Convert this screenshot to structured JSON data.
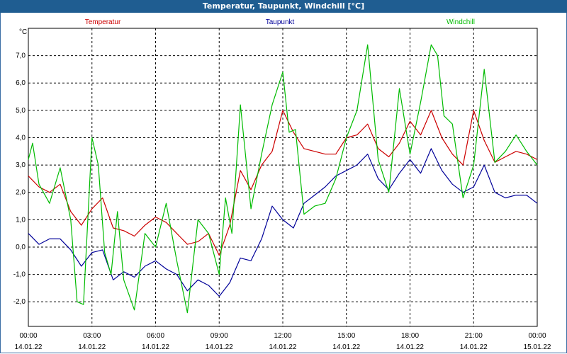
{
  "window": {
    "title": "Temperatur, Taupunkt, Windchill [°C]"
  },
  "chart_data": {
    "type": "line",
    "title": "Temperatur, Taupunkt, Windchill [°C]",
    "ylabel": "°C",
    "ylim": [
      -2.9,
      8.0
    ],
    "xlim": [
      0,
      24
    ],
    "grid": true,
    "legend_placement": "top",
    "y_ticks": [
      -2.0,
      -1.0,
      0.0,
      1.0,
      2.0,
      3.0,
      4.0,
      5.0,
      6.0,
      7.0
    ],
    "y_tick_labels": [
      "-2,0",
      "-1,0",
      "0,0",
      "1,0",
      "2,0",
      "3,0",
      "4,0",
      "5,0",
      "6,0",
      "7,0"
    ],
    "x_ticks": [
      0,
      3,
      6,
      9,
      12,
      15,
      18,
      21,
      24
    ],
    "x_tick_labels": [
      {
        "time": "00:00",
        "date": "14.01.22"
      },
      {
        "time": "03:00",
        "date": "14.01.22"
      },
      {
        "time": "06:00",
        "date": "14.01.22"
      },
      {
        "time": "09:00",
        "date": "14.01.22"
      },
      {
        "time": "12:00",
        "date": "14.01.22"
      },
      {
        "time": "15:00",
        "date": "14.01.22"
      },
      {
        "time": "18:00",
        "date": "14.01.22"
      },
      {
        "time": "21:00",
        "date": "14.01.22"
      },
      {
        "time": "00:00",
        "date": "15.01.22"
      }
    ],
    "series": [
      {
        "name": "Temperatur",
        "color": "#cc0000",
        "x": [
          0,
          0.5,
          1,
          1.5,
          2,
          2.5,
          3,
          3.5,
          4,
          4.5,
          5,
          5.5,
          6,
          6.5,
          7,
          7.5,
          8,
          8.5,
          9,
          9.5,
          10,
          10.5,
          11,
          11.5,
          12,
          12.5,
          13,
          13.5,
          14,
          14.5,
          15,
          15.5,
          16,
          16.5,
          17,
          17.5,
          18,
          18.5,
          19,
          19.5,
          20,
          20.5,
          21,
          21.5,
          22,
          22.5,
          23,
          23.5,
          24
        ],
        "values": [
          2.6,
          2.2,
          2.0,
          2.3,
          1.3,
          0.8,
          1.4,
          1.8,
          0.7,
          0.6,
          0.4,
          0.8,
          1.1,
          0.9,
          0.5,
          0.1,
          0.2,
          0.5,
          -0.3,
          0.8,
          2.8,
          2.1,
          3.0,
          3.5,
          5.0,
          4.2,
          3.6,
          3.5,
          3.4,
          3.4,
          4.0,
          4.1,
          4.5,
          3.6,
          3.3,
          3.8,
          4.6,
          4.1,
          5.0,
          4.0,
          3.4,
          3.0,
          5.0,
          3.9,
          3.1,
          3.3,
          3.5,
          3.4,
          3.2
        ]
      },
      {
        "name": "Taupunkt",
        "color": "#000099",
        "x": [
          0,
          0.5,
          1,
          1.5,
          2,
          2.5,
          3,
          3.5,
          4,
          4.5,
          5,
          5.5,
          6,
          6.5,
          7,
          7.5,
          8,
          8.5,
          9,
          9.5,
          10,
          10.5,
          11,
          11.5,
          12,
          12.5,
          13,
          13.5,
          14,
          14.5,
          15,
          15.5,
          16,
          16.5,
          17,
          17.5,
          18,
          18.5,
          19,
          19.5,
          20,
          20.5,
          21,
          21.5,
          22,
          22.5,
          23,
          23.5,
          24
        ],
        "values": [
          0.5,
          0.1,
          0.3,
          0.3,
          -0.1,
          -0.7,
          -0.2,
          -0.1,
          -1.2,
          -0.9,
          -1.1,
          -0.7,
          -0.5,
          -0.8,
          -1.0,
          -1.6,
          -1.2,
          -1.4,
          -1.8,
          -1.3,
          -0.4,
          -0.5,
          0.3,
          1.5,
          1.0,
          0.7,
          1.6,
          1.9,
          2.2,
          2.6,
          2.8,
          3.0,
          3.4,
          2.5,
          2.1,
          2.7,
          3.2,
          2.7,
          3.6,
          2.8,
          2.3,
          2.0,
          2.2,
          3.0,
          2.0,
          1.8,
          1.9,
          1.9,
          1.6
        ]
      },
      {
        "name": "Windchill",
        "color": "#00bb00",
        "x": [
          0,
          0.2,
          0.5,
          1,
          1.5,
          2,
          2.3,
          2.6,
          3,
          3.3,
          3.6,
          3.9,
          4.2,
          4.5,
          5,
          5.5,
          6,
          6.5,
          7,
          7.5,
          8,
          8.5,
          9,
          9.3,
          9.6,
          10,
          10.5,
          11,
          11.5,
          12,
          12.3,
          12.6,
          13,
          13.5,
          14,
          14.5,
          15,
          15.5,
          16,
          16.5,
          17,
          17.5,
          18,
          18.5,
          19,
          19.3,
          19.6,
          20,
          20.5,
          21,
          21.5,
          22,
          22.5,
          23,
          23.5,
          24
        ],
        "values": [
          3.2,
          3.8,
          2.3,
          1.6,
          2.9,
          1.0,
          -2.0,
          -2.1,
          4.0,
          3.0,
          -0.2,
          -1.0,
          1.3,
          -1.2,
          -2.3,
          0.5,
          0.0,
          1.6,
          -0.5,
          -2.4,
          1.0,
          0.5,
          -1.0,
          1.8,
          0.5,
          5.2,
          1.4,
          3.4,
          5.2,
          6.4,
          4.2,
          4.3,
          1.2,
          1.5,
          1.6,
          2.5,
          4.0,
          5.0,
          7.4,
          3.2,
          2.0,
          5.8,
          3.4,
          5.3,
          7.4,
          7.0,
          4.8,
          4.5,
          1.8,
          3.0,
          6.5,
          3.1,
          3.5,
          4.1,
          3.5,
          3.0
        ]
      }
    ]
  }
}
